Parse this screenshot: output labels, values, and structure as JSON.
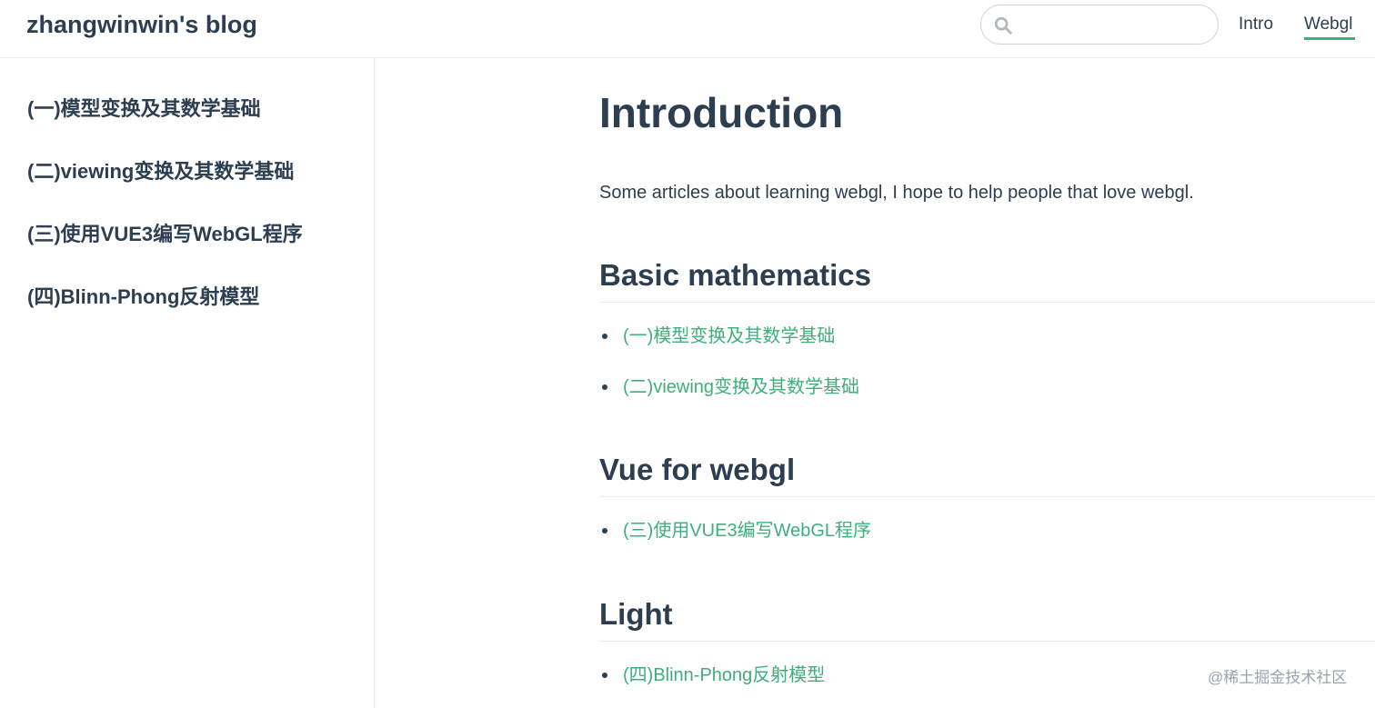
{
  "header": {
    "site_name": "zhangwinwin's blog",
    "search": {
      "value": "",
      "placeholder": ""
    },
    "nav": [
      {
        "label": "Intro",
        "active": false
      },
      {
        "label": "Webgl",
        "active": true
      }
    ],
    "accent_color": "#3eaf7c"
  },
  "sidebar": {
    "items": [
      {
        "label": "(一)模型变换及其数学基础"
      },
      {
        "label": "(二)viewing变换及其数学基础"
      },
      {
        "label": "(三)使用VUE3编写WebGL程序"
      },
      {
        "label": "(四)Blinn-Phong反射模型"
      }
    ]
  },
  "main": {
    "title": "Introduction",
    "intro": "Some articles about learning webgl, I hope to help people that love webgl.",
    "sections": [
      {
        "heading": "Basic mathematics",
        "links": [
          "(一)模型变换及其数学基础",
          "(二)viewing变换及其数学基础"
        ]
      },
      {
        "heading": "Vue for webgl",
        "links": [
          "(三)使用VUE3编写WebGL程序"
        ]
      },
      {
        "heading": "Light",
        "links": [
          "(四)Blinn-Phong反射模型"
        ]
      }
    ]
  },
  "watermark": "@稀土掘金技术社区"
}
